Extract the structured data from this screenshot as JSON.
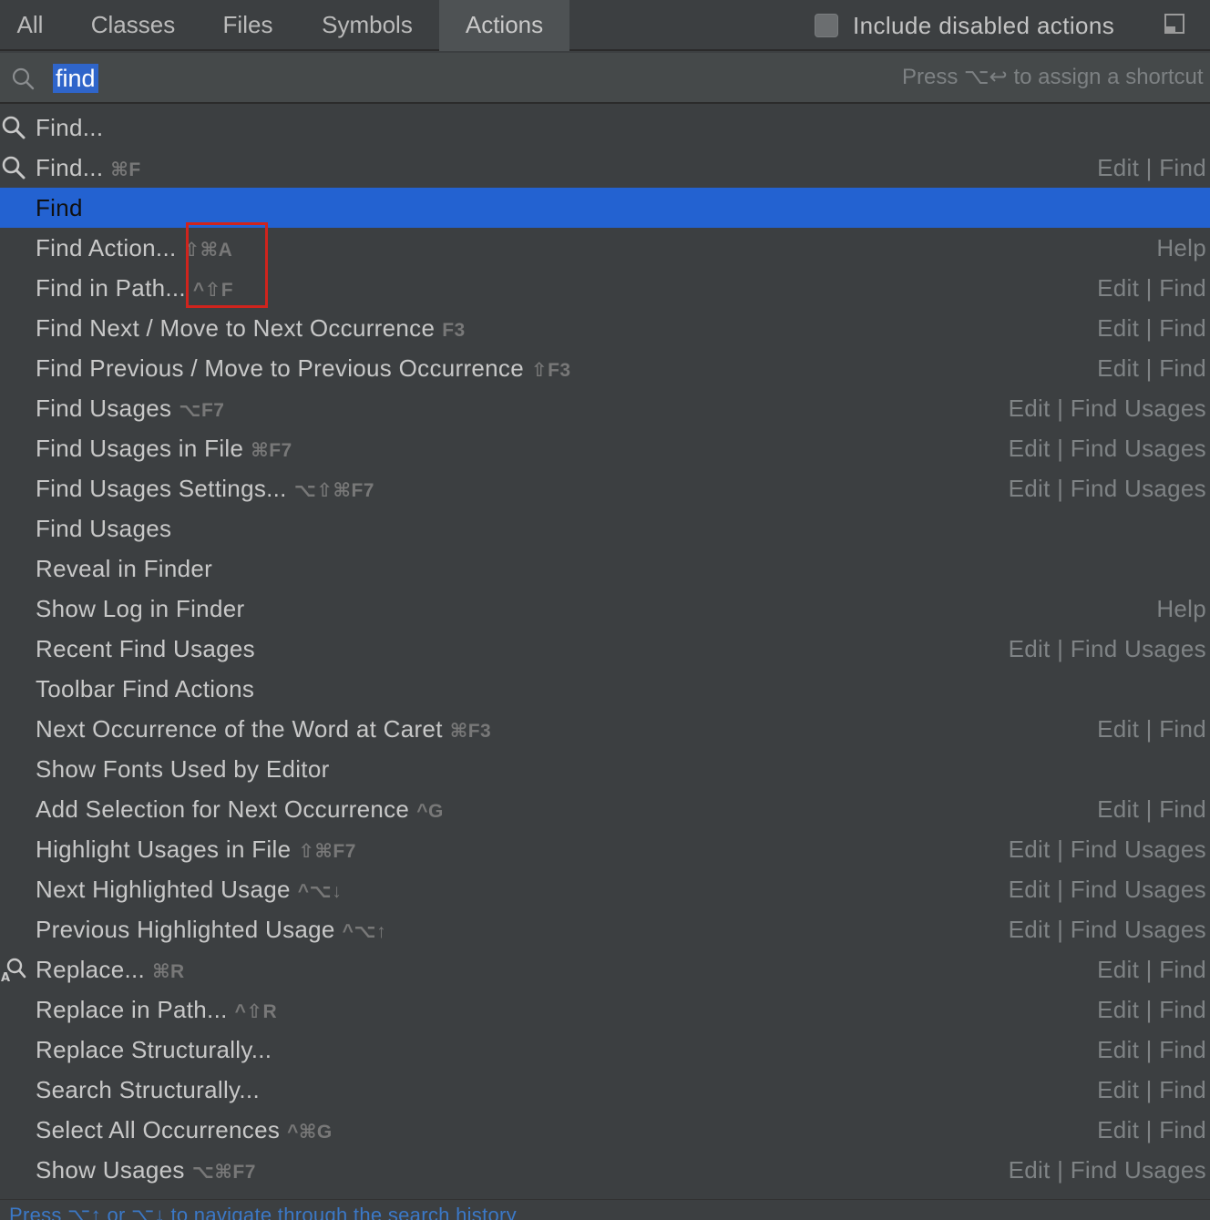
{
  "tabs": [
    {
      "label": "All"
    },
    {
      "label": "Classes"
    },
    {
      "label": "Files"
    },
    {
      "label": "Symbols"
    },
    {
      "label": "Actions",
      "active": true
    }
  ],
  "include_disabled": {
    "label": "Include disabled actions",
    "checked": false
  },
  "search": {
    "value": "find",
    "hint": "Press ⌥↩ to assign a shortcut"
  },
  "results": [
    {
      "name": "Find...",
      "shortcut": "",
      "group": "",
      "icon": "search-icon"
    },
    {
      "name": "Find...",
      "shortcut": "⌘F",
      "group": "Edit | Find",
      "icon": "search-icon"
    },
    {
      "name": "Find",
      "shortcut": "",
      "group": "",
      "selected": true
    },
    {
      "name": "Find Action...",
      "shortcut": "⇧⌘A",
      "group": "Help"
    },
    {
      "name": "Find in Path...",
      "shortcut": "^⇧F",
      "group": "Edit | Find"
    },
    {
      "name": "Find Next / Move to Next Occurrence",
      "shortcut": "F3",
      "group": "Edit | Find"
    },
    {
      "name": "Find Previous / Move to Previous Occurrence",
      "shortcut": "⇧F3",
      "group": "Edit | Find"
    },
    {
      "name": "Find Usages",
      "shortcut": "⌥F7",
      "group": "Edit | Find Usages"
    },
    {
      "name": "Find Usages in File",
      "shortcut": "⌘F7",
      "group": "Edit | Find Usages"
    },
    {
      "name": "Find Usages Settings...",
      "shortcut": "⌥⇧⌘F7",
      "group": "Edit | Find Usages"
    },
    {
      "name": "Find Usages",
      "shortcut": "",
      "group": ""
    },
    {
      "name": "Reveal in Finder",
      "shortcut": "",
      "group": ""
    },
    {
      "name": "Show Log in Finder",
      "shortcut": "",
      "group": "Help"
    },
    {
      "name": "Recent Find Usages",
      "shortcut": "",
      "group": "Edit | Find Usages"
    },
    {
      "name": "Toolbar Find Actions",
      "shortcut": "",
      "group": ""
    },
    {
      "name": "Next Occurrence of the Word at Caret",
      "shortcut": "⌘F3",
      "group": "Edit | Find"
    },
    {
      "name": "Show Fonts Used by Editor",
      "shortcut": "",
      "group": ""
    },
    {
      "name": "Add Selection for Next Occurrence",
      "shortcut": "^G",
      "group": "Edit | Find"
    },
    {
      "name": "Highlight Usages in File",
      "shortcut": "⇧⌘F7",
      "group": "Edit | Find Usages"
    },
    {
      "name": "Next Highlighted Usage",
      "shortcut": "^⌥↓",
      "group": "Edit | Find Usages"
    },
    {
      "name": "Previous Highlighted Usage",
      "shortcut": "^⌥↑",
      "group": "Edit | Find Usages"
    },
    {
      "name": "Replace...",
      "shortcut": "⌘R",
      "group": "Edit | Find",
      "icon": "replace-icon"
    },
    {
      "name": "Replace in Path...",
      "shortcut": "^⇧R",
      "group": "Edit | Find"
    },
    {
      "name": "Replace Structurally...",
      "shortcut": "",
      "group": "Edit | Find"
    },
    {
      "name": "Search Structurally...",
      "shortcut": "",
      "group": "Edit | Find"
    },
    {
      "name": "Select All Occurrences",
      "shortcut": "^⌘G",
      "group": "Edit | Find"
    },
    {
      "name": "Show Usages",
      "shortcut": "⌥⌘F7",
      "group": "Edit | Find Usages"
    }
  ],
  "footer": {
    "text": "Press ⌥↑ or ⌥↓ to navigate through the search history"
  },
  "colors": {
    "background": "#3c3f41",
    "selection": "#2362d1",
    "search_highlight": "#2f65ca",
    "annotation_box": "#d0241d",
    "footer_link": "#3b78c7"
  }
}
